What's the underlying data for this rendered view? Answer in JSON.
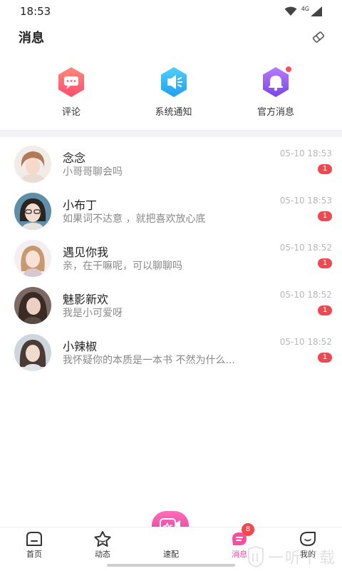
{
  "status_bar": {
    "time": "18:53",
    "network": "4G"
  },
  "header": {
    "title": "消息"
  },
  "shortcuts": [
    {
      "label": "评论",
      "icon": "comment-icon",
      "color": "#ff5a6e"
    },
    {
      "label": "系统通知",
      "icon": "speaker-icon",
      "color": "#2bb3f0"
    },
    {
      "label": "官方消息",
      "icon": "bell-icon",
      "color": "#9a5cf0",
      "has_dot": true
    }
  ],
  "messages": [
    {
      "name": "念念",
      "preview": "小哥哥聊会吗",
      "time": "05-10 18:53",
      "unread": "1"
    },
    {
      "name": "小布丁",
      "preview": "如果词不达意 ，就把喜欢放心底",
      "time": "05-10 18:53",
      "unread": "1"
    },
    {
      "name": "遇见你我",
      "preview": "亲，在干嘛呢，可以聊聊吗",
      "time": "05-10 18:52",
      "unread": "1"
    },
    {
      "name": "魅影新欢",
      "preview": "我是小可爱呀",
      "time": "05-10 18:52",
      "unread": "1"
    },
    {
      "name": "小辣椒",
      "preview": "我怀疑你的本质是一本书 不然为什么...",
      "time": "05-10 18:52",
      "unread": "1"
    }
  ],
  "bottom_nav": {
    "items": [
      {
        "label": "首页",
        "icon": "home-icon"
      },
      {
        "label": "动态",
        "icon": "star-icon"
      },
      {
        "label": "速配",
        "icon": "match-icon"
      },
      {
        "label": "消息",
        "icon": "message-icon",
        "badge": "8",
        "active": true
      },
      {
        "label": "我的",
        "icon": "profile-icon"
      }
    ]
  },
  "watermark": {
    "text": "一听下载"
  },
  "colors": {
    "accent_pink": "#f54d9f",
    "badge_red": "#f0484e"
  }
}
